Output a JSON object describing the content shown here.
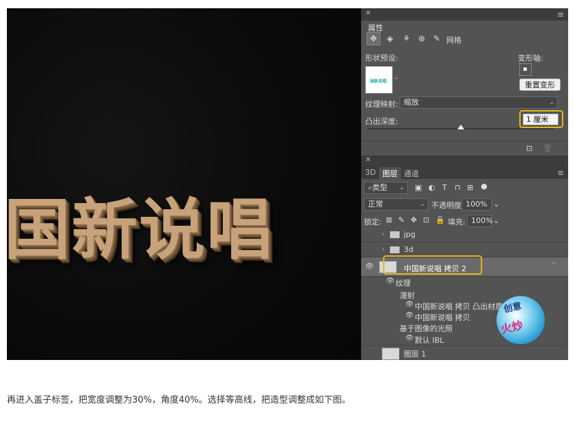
{
  "canvas": {
    "text": "国新说唱"
  },
  "properties": {
    "title": "属性",
    "icons": [
      "mesh-icon",
      "deform-icon",
      "cap-icon",
      "coordinates-icon",
      "brush-icon"
    ],
    "mesh_label": "网格",
    "shape_preset_label": "形状预设:",
    "deform_axis_label": "变形轴:",
    "reset_deform": "重置变形",
    "texture_map_label": "纹理映射:",
    "texture_map_value": "缩放",
    "extrusion_label": "凸出深度:",
    "extrusion_value": "1 厘米",
    "extrusion_level": 0.5
  },
  "layers": {
    "tabs": [
      "3D",
      "图层",
      "通道"
    ],
    "filter_value": "类型",
    "blend_mode": "正常",
    "opacity_label": "不透明度:",
    "opacity_value": "100%",
    "lock_label": "锁定:",
    "fill_label": "填充:",
    "fill_value": "100%",
    "items": [
      {
        "label": "jpg"
      },
      {
        "label": "3d"
      },
      {
        "label": "中国新说唱 拷贝 2"
      },
      {
        "label": "纹理"
      },
      {
        "label": "漫射"
      },
      {
        "label": "中国新说唱 拷贝 凸出材质 - 默认"
      },
      {
        "label": "中国新说唱 拷贝"
      },
      {
        "label": "基于图像的光照"
      },
      {
        "label": "默认 IBL"
      },
      {
        "label": "图层 1"
      }
    ]
  },
  "caption": "再进入盖子标签，把宽度调整为30%，角度40%。选择等高线，把造型调整成如下图。",
  "colors": {
    "highlight": "#e5b61c",
    "panel": "#535353"
  }
}
